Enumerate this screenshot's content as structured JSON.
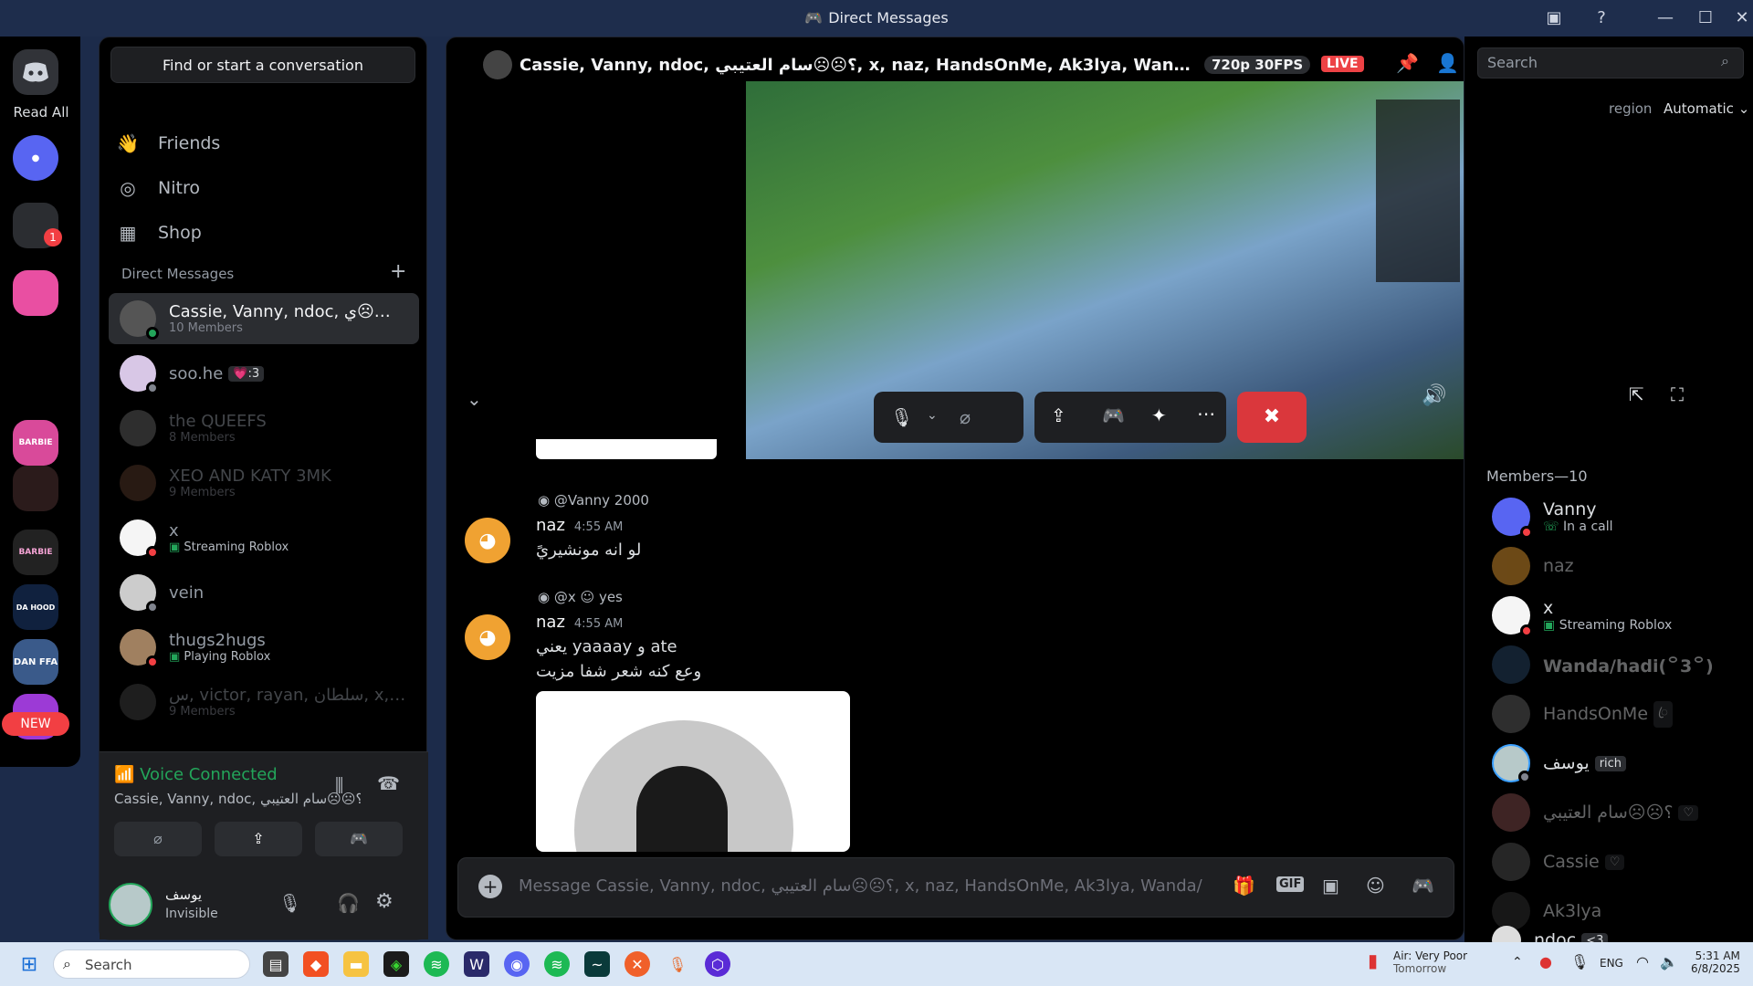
{
  "window": {
    "title": "Direct Messages"
  },
  "rail": {
    "read_all": "Read All",
    "unread_count": "1",
    "new_label": "NEW",
    "servers": [
      "BARBIE",
      "DA HOOD",
      "DAN FFA"
    ]
  },
  "dm_sidebar": {
    "find_button": "Find or start a conversation",
    "nav": [
      {
        "label": "Friends"
      },
      {
        "label": "Nitro"
      },
      {
        "label": "Shop"
      }
    ],
    "section_title": "Direct Messages",
    "conversations": [
      {
        "name": "Cassie, Vanny, ndoc, ؟☹☹ي…",
        "sub": "10 Members"
      },
      {
        "name": "soo.he",
        "badge": "💗:3"
      },
      {
        "name": "the QUEEFS",
        "sub": "8 Members"
      },
      {
        "name": "XEO AND KATY 3MK",
        "sub": "9 Members"
      },
      {
        "name": "x",
        "sub": "Streaming Roblox"
      },
      {
        "name": "vein"
      },
      {
        "name": "thugs2hugs",
        "sub": "Playing Roblox"
      },
      {
        "name": "س, victor, rayan, سلطان, x, ؟☹…",
        "sub": "9 Members"
      }
    ]
  },
  "voice": {
    "status": "Voice Connected",
    "channel": "Cassie, Vanny, ndoc, ؟☹☹سام العتيبي, x, naz, ..."
  },
  "user": {
    "name": "يوسف",
    "status": "Invisible"
  },
  "call": {
    "title": "Cassie, Vanny, ndoc, ؟☹☹سام العتيبي, x, naz, HandsOnMe, Ak3lya, Wanda/hadi(꒪3꒪)",
    "quality": "720p 30FPS",
    "live": "LIVE",
    "search_placeholder": "Search",
    "region_label": "region",
    "region_value": "Automatic"
  },
  "messages": [
    {
      "reply_to": "@Vanny 2000",
      "author": "naz",
      "time": "4:55 AM",
      "lines": [
        "لو انه مونشيريً"
      ]
    },
    {
      "reply_to": "@x",
      "reply_text": "yes",
      "author": "naz",
      "time": "4:55 AM",
      "lines": [
        "يعني yaaaay و ate",
        "وعع كنه شعر شفا مزيت"
      ]
    }
  ],
  "composer": {
    "placeholder": "Message Cassie, Vanny, ndoc, ؟☹☹سام العتيبي, x, naz, HandsOnMe, Ak3lya, Wanda/had..."
  },
  "members": {
    "header": "Members—10",
    "list": [
      {
        "name": "Vanny",
        "sub": "In a call"
      },
      {
        "name": "naz"
      },
      {
        "name": "x",
        "sub": "Streaming Roblox"
      },
      {
        "name": "Wanda/hadi(꒪3꒪)"
      },
      {
        "name": "HandsOnMe",
        "badge": "ꦿ"
      },
      {
        "name": "يوسف",
        "badge": "rich"
      },
      {
        "name": "؟☹☹سام العتيبي",
        "badge": "♡"
      },
      {
        "name": "Cassie",
        "badge": "♡"
      },
      {
        "name": "Ak3lya"
      },
      {
        "name": "ndoc",
        "badge": "<3"
      }
    ]
  },
  "taskbar": {
    "search": "Search",
    "weather_title": "Air: Very Poor",
    "weather_sub": "Tomorrow",
    "lang": "ENG",
    "time": "5:31 AM",
    "date": "6/8/2025"
  },
  "colors": {
    "accent": "#5865f2",
    "online": "#23a55a",
    "dnd": "#f23f43",
    "voice_green": "#23a55a",
    "live_red": "#ed4245",
    "avatar_orange": "#f0a232"
  }
}
